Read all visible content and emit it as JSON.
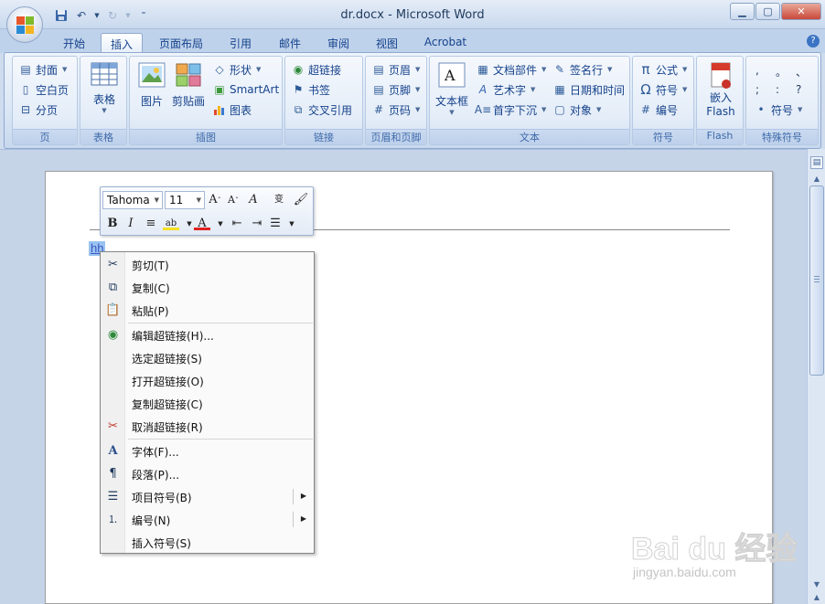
{
  "window": {
    "title": "dr.docx - Microsoft Word",
    "controls": [
      "minimize",
      "maximize",
      "close"
    ]
  },
  "tabs": [
    "开始",
    "插入",
    "页面布局",
    "引用",
    "邮件",
    "审阅",
    "视图",
    "Acrobat"
  ],
  "active_tab": "插入",
  "ribbon": {
    "groups": {
      "page": {
        "label": "页",
        "items": [
          "封面",
          "空白页",
          "分页"
        ]
      },
      "table": {
        "label": "表格",
        "button": "表格"
      },
      "illustrations": {
        "label": "插图",
        "large": [
          "图片",
          "剪贴画"
        ],
        "small": [
          "形状",
          "SmartArt",
          "图表"
        ]
      },
      "links": {
        "label": "链接",
        "items": [
          "超链接",
          "书签",
          "交叉引用"
        ]
      },
      "header_footer": {
        "label": "页眉和页脚",
        "items": [
          "页眉",
          "页脚",
          "页码"
        ]
      },
      "text": {
        "label": "文本",
        "large": "文本框",
        "col1": [
          "文档部件",
          "艺术字",
          "首字下沉"
        ],
        "col2": [
          "签名行",
          "日期和时间",
          "对象"
        ]
      },
      "symbols": {
        "label": "符号",
        "items": [
          "公式",
          "符号",
          "编号"
        ]
      },
      "flash": {
        "label": "Flash",
        "button_line1": "嵌入",
        "button_line2": "Flash"
      },
      "special": {
        "label": "特殊符号",
        "chars": [
          ",",
          "。",
          "、",
          ";",
          ":",
          "?"
        ],
        "button": "符号"
      }
    }
  },
  "document": {
    "selected_text": "hh"
  },
  "mini_toolbar": {
    "font": "Tahoma",
    "size": "11"
  },
  "context_menu": {
    "items": [
      {
        "label": "剪切(T)",
        "icon": "scissors-icon"
      },
      {
        "label": "复制(C)",
        "icon": "copy-icon"
      },
      {
        "label": "粘贴(P)",
        "icon": "paste-icon"
      },
      {
        "label": "编辑超链接(H)...",
        "icon": "globe-link-icon"
      },
      {
        "label": "选定超链接(S)",
        "icon": ""
      },
      {
        "label": "打开超链接(O)",
        "icon": ""
      },
      {
        "label": "复制超链接(C)",
        "icon": ""
      },
      {
        "label": "取消超链接(R)",
        "icon": "unlink-icon"
      },
      {
        "label": "字体(F)...",
        "icon": "font-icon"
      },
      {
        "label": "段落(P)...",
        "icon": "paragraph-icon"
      },
      {
        "label": "项目符号(B)",
        "icon": "bullets-icon"
      },
      {
        "label": "编号(N)",
        "icon": "numbering-icon"
      },
      {
        "label": "插入符号(S)",
        "icon": ""
      }
    ]
  },
  "watermark": {
    "brand": "Bai du 经验",
    "url": "jingyan.baidu.com"
  }
}
